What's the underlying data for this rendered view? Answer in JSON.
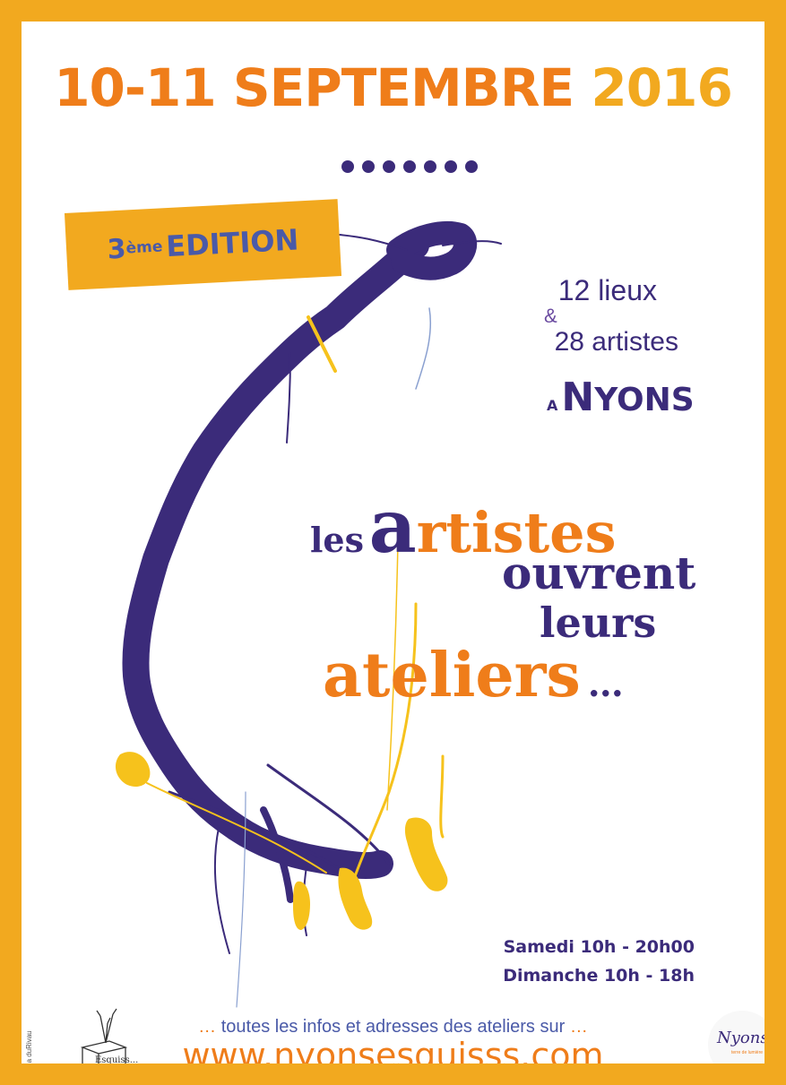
{
  "poster": {
    "date": "10-11 SEPTEMBRE",
    "year": "2016",
    "edition": {
      "number": "3",
      "suffix": "ème",
      "label": "EDITION"
    },
    "counts": {
      "lieux": "12 lieux",
      "ampersand": "&",
      "artistes": "28 artistes"
    },
    "location": {
      "prefix": "A",
      "initial": "N",
      "rest": "YONS"
    },
    "title": {
      "les": "les",
      "a": "a",
      "rtistes": "rtistes",
      "ouvrent": "ouvrent",
      "leurs": "leurs",
      "ateliers": "ateliers",
      "ellipsis": "…"
    },
    "hours": {
      "samedi": "Samedi 10h - 20h00",
      "dimanche": "Dimanche 10h - 18h"
    },
    "info": {
      "lead": "… ",
      "text": "toutes les infos et adresses des ateliers sur",
      "trail": " …"
    },
    "url": "www.nyonsesquisss.com",
    "credit": "© Gaia duRivau",
    "logo_left": {
      "text": "Esquiss..."
    },
    "logo_right": {
      "text": "Nyons",
      "subtitle": "terre de lumière"
    }
  },
  "colors": {
    "frame": "#f2a91f",
    "orange": "#ef7d1a",
    "purple": "#3b2b7a",
    "blue": "#4a5aa8",
    "yellow": "#f6c21c"
  }
}
